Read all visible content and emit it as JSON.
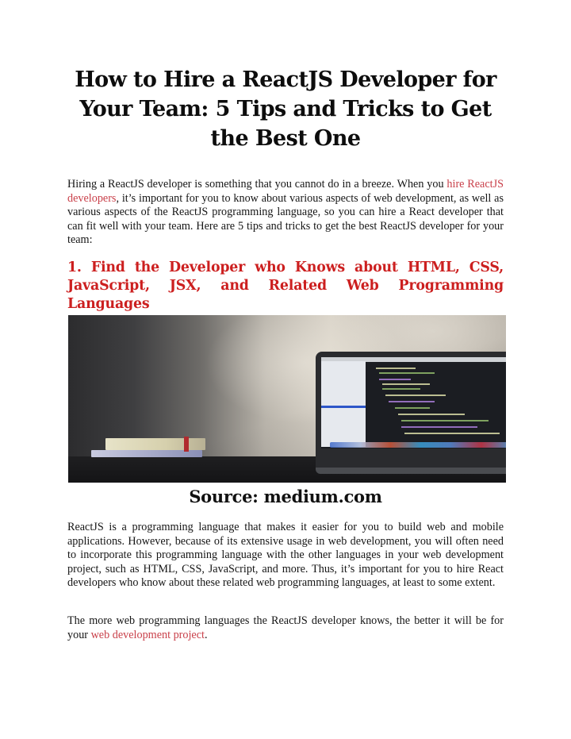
{
  "document": {
    "title": "How to Hire a ReactJS Developer for Your Team: 5 Tips and Tricks to Get the Best One",
    "intro": {
      "before_link": "Hiring a ReactJS developer is something that you cannot do in a breeze. When you ",
      "link_text": "hire ReactJS developers",
      "after_link": ", it’s important for you to know about various aspects of web development, as well as various aspects of the ReactJS programming language, so you can hire a React developer that can fit well with your team. Here are 5 tips and tricks to get the best ReactJS developer for your team:"
    },
    "section_1": {
      "heading": "1. Find the Developer who Knows about HTML, CSS, JavaScript, JSX, and Related Web Programming Languages",
      "image": {
        "description": "Laptop displaying code editor next to a stack of books on a dark desk",
        "caption": "Source: medium.com"
      },
      "paragraph_1": "ReactJS is a programming language that makes it easier for you to build web and mobile applications. However, because of its extensive usage in web development, you will often need to incorporate this programming language with the other languages in your web development project, such as HTML, CSS, JavaScript, and more. Thus, it’s important for you to hire React developers who know about these related web programming languages, at least to some extent.",
      "paragraph_2": {
        "before_link": "The more web programming languages the ReactJS developer knows, the better it will be for your ",
        "link_text": "web development project",
        "after_link": "."
      }
    }
  },
  "colors": {
    "heading_red": "#cc1f1f",
    "link_red": "#c9404a",
    "body_text": "#161616"
  }
}
